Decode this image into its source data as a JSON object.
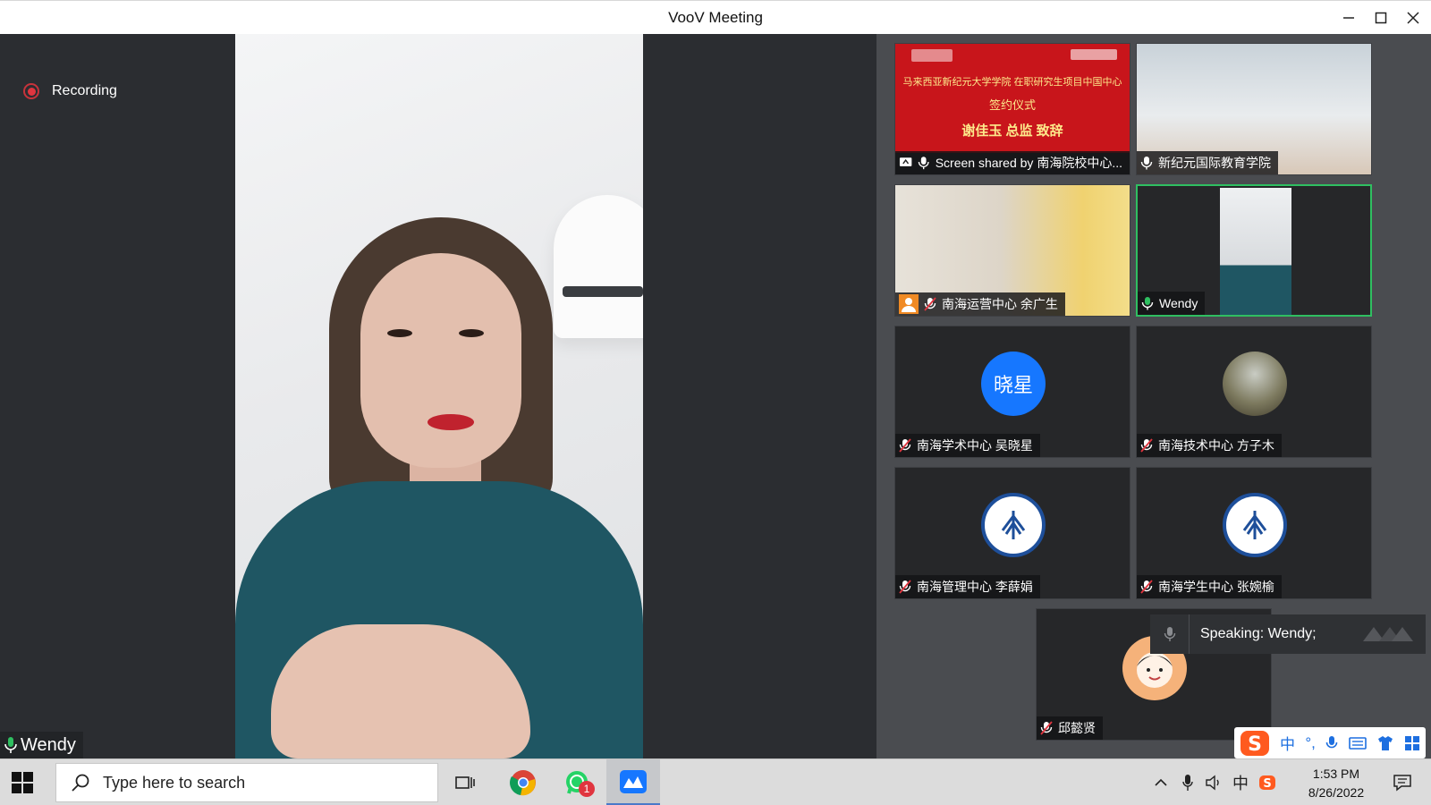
{
  "window": {
    "title": "VooV Meeting",
    "controls": [
      "minimize-icon",
      "maximize-icon",
      "close-icon"
    ]
  },
  "meeting": {
    "recording_label": "Recording",
    "main_speaker_name": "Wendy",
    "speaking_indicator": "Speaking: Wendy;",
    "participants": [
      {
        "label": "Screen shared by 南海院校中心...",
        "type": "screen-share"
      },
      {
        "label": "新纪元国际教育学院",
        "type": "video"
      },
      {
        "label": "南海运营中心 余广生",
        "type": "video"
      },
      {
        "label": "Wendy",
        "type": "video",
        "active": true
      },
      {
        "label": "南海学术中心 吴晓星",
        "type": "avatar",
        "avatar_text": "晓星",
        "avatar_color": "#1677ff"
      },
      {
        "label": "南海技术中心 方子木",
        "type": "avatar-image"
      },
      {
        "label": "南海管理中心 李薛娟",
        "type": "emblem"
      },
      {
        "label": "南海学生中心 张婉榆",
        "type": "emblem"
      },
      {
        "label": "邱懿贤",
        "type": "cartoon-avatar"
      }
    ],
    "shared_slide": {
      "line1": "马来西亚新纪元大学学院 在职研究生项目中国中心",
      "line2": "签约仪式",
      "line3": "谢佳玉 总监 致辞"
    }
  },
  "ime": {
    "items": [
      "中",
      "°,",
      "mic",
      "keyboard",
      "shirt",
      "grid"
    ]
  },
  "taskbar": {
    "search_placeholder": "Type here to search",
    "whatsapp_badge": "1",
    "tray_lang": "中",
    "time": "1:53 PM",
    "date": "8/26/2022"
  },
  "colors": {
    "active_border": "#2fbf61",
    "recording_red": "#e0353f",
    "meeting_bg": "#2b2d31",
    "accent_blue": "#1677ff"
  }
}
